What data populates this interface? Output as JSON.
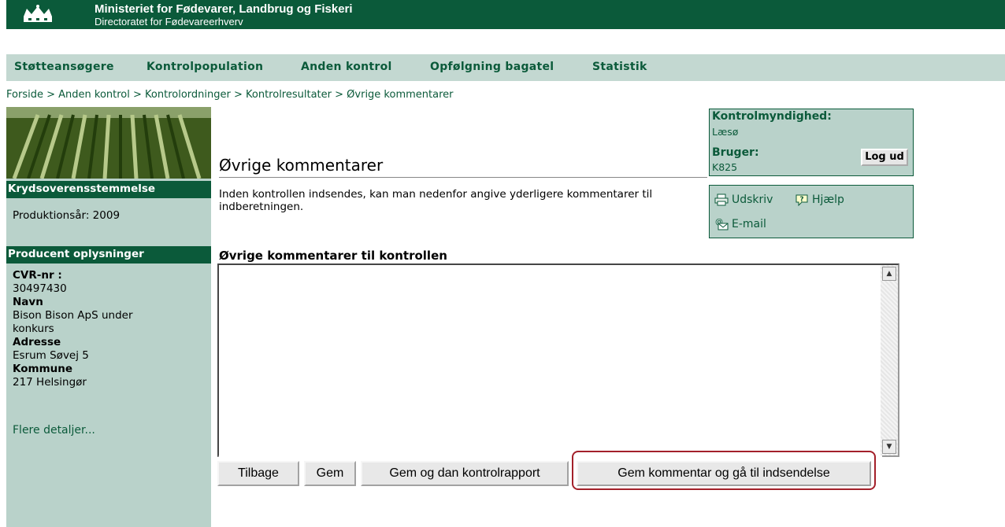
{
  "header": {
    "ministry": "Ministeriet for Fødevarer, Landbrug og Fiskeri",
    "directorate": "Directoratet for Fødevareerhverv",
    "logo_icon": "crown-icon",
    "brand_color": "#0b5a3a"
  },
  "menu": {
    "items": [
      "Støtteansøgere",
      "Kontrolpopulation",
      "Anden kontrol",
      "Opfølgning bagatel",
      "Statistik"
    ]
  },
  "breadcrumb": [
    "Forside",
    "Anden kontrol",
    "Kontrolordninger",
    "Kontrolresultater",
    "Øvrige kommentarer"
  ],
  "sidebar": {
    "section1_title": "Krydsoverensstemmelse",
    "production_year": "Produktionsår: 2009",
    "section2_title": "Producent oplysninger",
    "cvr_label": "CVR-nr :",
    "cvr_value": "30497430",
    "name_label": "Navn",
    "name_value_line1": "Bison Bison ApS under",
    "name_value_line2": "konkurs",
    "address_label": "Adresse",
    "address_value": "Esrum Søvej 5",
    "municipality_label": "Kommune",
    "municipality_value": "217 Helsingør",
    "more_link": "Flere detaljer..."
  },
  "main": {
    "title": "Øvrige kommentarer",
    "intro": "Inden kontrollen indsendes, kan man nedenfor angive yderligere kommentarer til indberetningen.",
    "section_label": "Øvrige kommentarer til kontrollen",
    "comment_value": ""
  },
  "infobox": {
    "authority_label": "Kontrolmyndighed:",
    "authority_value": "Læsø",
    "user_label": "Bruger:",
    "user_value": "K825",
    "logout_label": "Log ud"
  },
  "tools": {
    "print": "Udskriv",
    "help": "Hjælp",
    "email": "E-mail"
  },
  "buttons": {
    "back": "Tilbage",
    "save": "Gem",
    "save_report": "Gem og dan kontrolrapport",
    "save_submit": "Gem kommentar og gå til indsendelse"
  },
  "colors": {
    "menu_bg": "#c3d8d1",
    "sidebar_bg": "#b9d2ca",
    "highlight": "#a3202a"
  }
}
